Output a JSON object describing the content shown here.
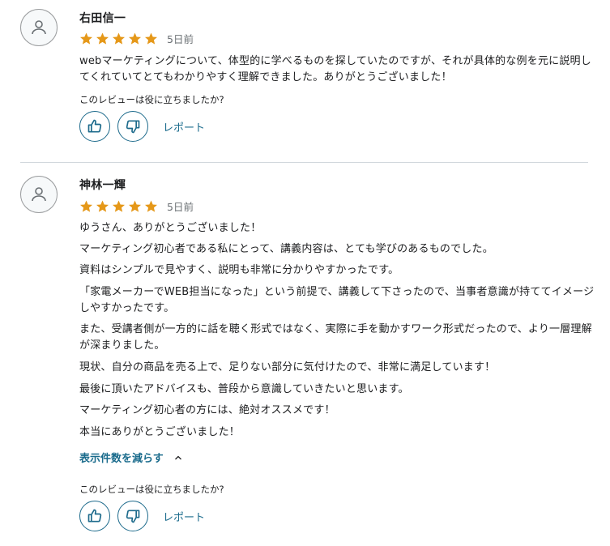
{
  "reviews": [
    {
      "avatar_icon": "user-icon",
      "name": "右田信一",
      "rating": 5,
      "date": "5日前",
      "paragraphs": [
        "webマーケティングについて、体型的に学べるものを探していたのですが、それが具体的な例を元に説明してくれていてとてもわかりやすく理解できました。ありがとうございました！"
      ],
      "helpful_question": "このレビューは役に立ちましたか?",
      "like_icon": "thumbs-up-icon",
      "dislike_icon": "thumbs-down-icon",
      "report_label": "レポート"
    },
    {
      "avatar_icon": "user-icon",
      "name": "神林一輝",
      "rating": 5,
      "date": "5日前",
      "paragraphs": [
        "ゆうさん、ありがとうございました！",
        "マーケティング初心者である私にとって、講義内容は、とても学びのあるものでした。",
        "資料はシンプルで見やすく、説明も非常に分かりやすかったです。",
        "「家電メーカーでWEB担当になった」という前提で、講義して下さったので、当事者意識が持ててイメージしやすかったです。",
        "また、受講者側が一方的に話を聴く形式ではなく、実際に手を動かすワーク形式だったので、より一層理解が深まりました。",
        "現状、自分の商品を売る上で、足りない部分に気付けたので、非常に満足しています！",
        "最後に頂いたアドバイスも、普段から意識していきたいと思います。",
        "マーケティング初心者の方には、絶対オススメです！",
        "本当にありがとうございました！"
      ],
      "collapse_label": "表示件数を減らす",
      "collapse_icon": "chevron-up-icon",
      "helpful_question": "このレビューは役に立ちましたか?",
      "like_icon": "thumbs-up-icon",
      "dislike_icon": "thumbs-down-icon",
      "report_label": "レポート"
    }
  ],
  "colors": {
    "star": "#e59819",
    "link": "#1a6b8c",
    "divider": "#d1d7dc",
    "text": "#1c1d1f",
    "muted": "#6a6f73"
  }
}
